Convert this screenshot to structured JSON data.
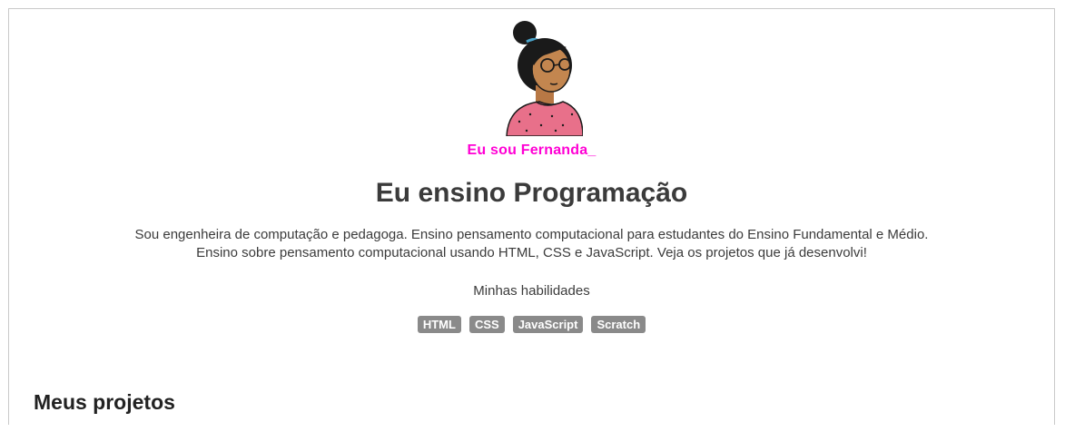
{
  "profile": {
    "handle": "Eu sou Fernanda_",
    "headline": "Eu ensino Programação",
    "bio_line_1": "Sou engenheira de computação e pedagoga. Ensino pensamento computacional para estudantes do Ensino Fundamental e Médio.",
    "bio_line_2": "Ensino sobre pensamento computacional usando HTML, CSS e JavaScript. Veja os projetos que já desenvolvi!",
    "avatar_icon": "avatar-illustration"
  },
  "skills": {
    "title": "Minhas habilidades",
    "items": [
      "HTML",
      "CSS",
      "JavaScript",
      "Scratch"
    ]
  },
  "projects": {
    "title": "Meus projetos"
  },
  "colors": {
    "handle": "#ff00d4",
    "badge_bg": "#8a8a8a",
    "text": "#3b3b3b"
  }
}
